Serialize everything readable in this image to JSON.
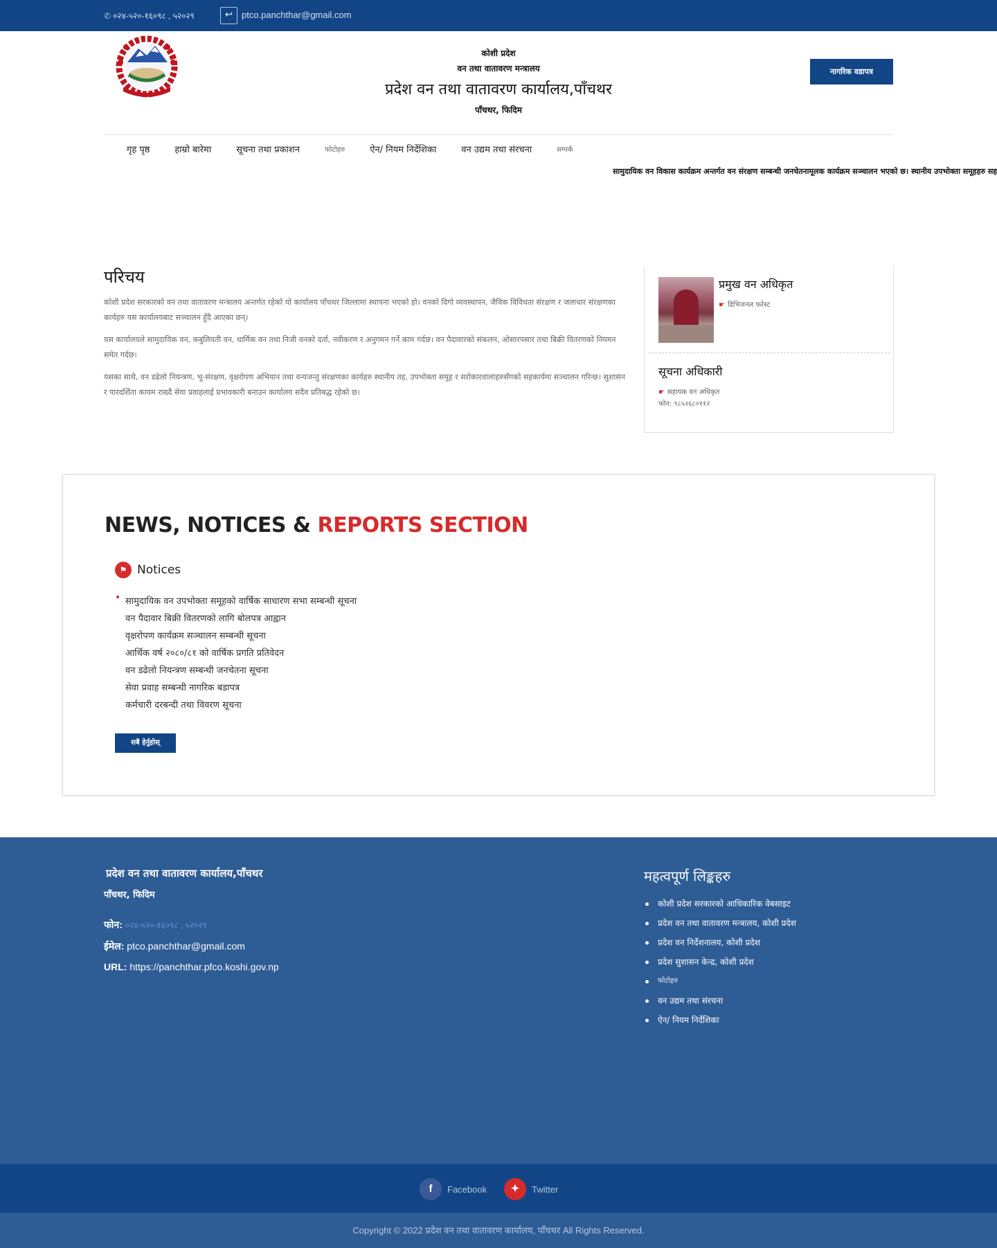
{
  "topbar": {
    "phone": "०२४-५२०-१६०९८ , ५२०२९",
    "email": "ptco.panchthar@gmail.com"
  },
  "header": {
    "line1": "कोशी प्रदेश",
    "line2": "वन तथा वातावरण मन्त्रालय",
    "title": "प्रदेश वन तथा वातावरण कार्यालय,पाँचथर",
    "line4": "पाँचथर, फिदिम",
    "button": "नागरिक वडापत्र"
  },
  "nav": [
    {
      "label": "गृह पृष्ठ"
    },
    {
      "label": "हाम्रो बारेमा"
    },
    {
      "label": "सूचना तथा प्रकाशन"
    },
    {
      "label": "फोटोहरु",
      "small": true
    },
    {
      "label": "ऐन/ नियम निर्देशिका"
    },
    {
      "label": "वन उद्यम तथा संरचना"
    },
    {
      "label": "सम्पर्क",
      "small": true
    }
  ],
  "marquee": "सामुदायिक वन विकास कार्यक्रम अन्तर्गत वन संरक्षण सम्बन्धी जनचेतनामूलक कार्यक्रम सञ्चालन भएको छ। स्थानीय उपभोक्ता समूहहरु सहभागी हुनु हुनेछ।",
  "about": {
    "heading": "परिचय",
    "p1": "कोशी प्रदेश सरकारको वन तथा वातावरण मन्त्रालय अन्तर्गत रहेको यो कार्यालय पाँचथर जिल्लामा स्थापना भएको हो। वनको दिगो व्यवस्थापन, जैविक विविधता संरक्षण र जलाधार संरक्षणका कार्यहरु यस कार्यालयबाट सञ्चालन हुँदै आएका छन्।",
    "p2": "यस कार्यालयले सामुदायिक वन, कबुलियती वन, धार्मिक वन तथा निजी वनको दर्ता, नवीकरण र अनुगमन गर्ने काम गर्दछ। वन पैदावारको संकलन, ओसारपसार तथा बिक्री वितरणको नियमन समेत गर्दछ।",
    "p3": "यसका साथै, वन डढेलो नियन्त्रण, भू-संरक्षण, वृक्षरोपण अभियान तथा वन्यजन्तु संरक्षणका कार्यहरु स्थानीय तह, उपभोक्ता समूह र सरोकारवालाहरुसँगको सहकार्यमा सञ्चालन गरिन्छ। सुशासन र पारदर्शिता कायम राख्दै सेवा प्रवाहलाई प्रभावकारी बनाउन कार्यालय सदैव प्रतिबद्ध रहेको छ।"
  },
  "officials": [
    {
      "name": "प्रमुख वन अधिकृत",
      "role": "डिभिजनल फरेस्ट"
    },
    {
      "name": "सूचना अधिकारी",
      "role": "सहायक वन अधिकृत",
      "phone": "फोन: ९८५२६८०११२"
    }
  ],
  "news": {
    "title_a": "NEWS, NOTICES & ",
    "title_b": "REPORTS SECTION",
    "tab_label": "Notices",
    "items": [
      "सामुदायिक वन उपभोक्ता समूहको वार्षिक साधारण सभा सम्बन्धी सूचना",
      "वन पैदावार बिक्री वितरणको लागि बोलपत्र आह्वान",
      "वृक्षरोपण कार्यक्रम सञ्चालन सम्बन्धी सूचना",
      "आर्थिक वर्ष २०८०/८१ को वार्षिक प्रगति प्रतिवेदन",
      "वन डढेलो नियन्त्रण सम्बन्धी जनचेतना सूचना",
      "सेवा प्रवाह सम्बन्धी नागरिक बडापत्र",
      "कर्मचारी दरबन्दी तथा विवरण सूचना"
    ],
    "more_button": "सबै हेर्नुहोस्"
  },
  "footer": {
    "name": "प्रदेश वन तथा वातावरण कार्यालय,पाँचथर",
    "location": "पाँचथर, फिदिम",
    "phone_label": "फोन:",
    "phone_value": "०२४-५२०-१६०९८ , ५२०२९",
    "email_label": "ईमेल:",
    "email_value": "ptco.panchthar@gmail.com",
    "url_label": "URL:",
    "url_value": "https://panchthar.pfco.koshi.gov.np",
    "links_heading": "महत्वपूर्ण लिङ्कहरु",
    "links": [
      {
        "label": "कोशी प्रदेश सरकारको आधिकारिक वेबसाइट"
      },
      {
        "label": "प्रदेश वन तथा वातावरण मन्त्रालय, कोशी प्रदेश"
      },
      {
        "label": "प्रदेश वन निर्देशनालय, कोशी प्रदेश"
      },
      {
        "label": "प्रदेश सुशासन केन्द्र, कोशी प्रदेश"
      },
      {
        "label": "फोटोहरु",
        "small": true
      },
      {
        "label": "वन उद्यम तथा संरचना"
      },
      {
        "label": "ऐन/ नियम निर्देशिका"
      }
    ]
  },
  "social": {
    "facebook": "Facebook",
    "twitter": "Twitter",
    "facebook_color": "#3b5998",
    "twitter_color": "#d62b2b"
  },
  "copyright": "Copyright © 2022 प्रदेश वन तथा वातावरण कार्यालय, पाँचथर All Rights Reserved.",
  "colors": {
    "primary": "#114586",
    "accent": "#d62b2b",
    "footer": "#2e5c95"
  }
}
